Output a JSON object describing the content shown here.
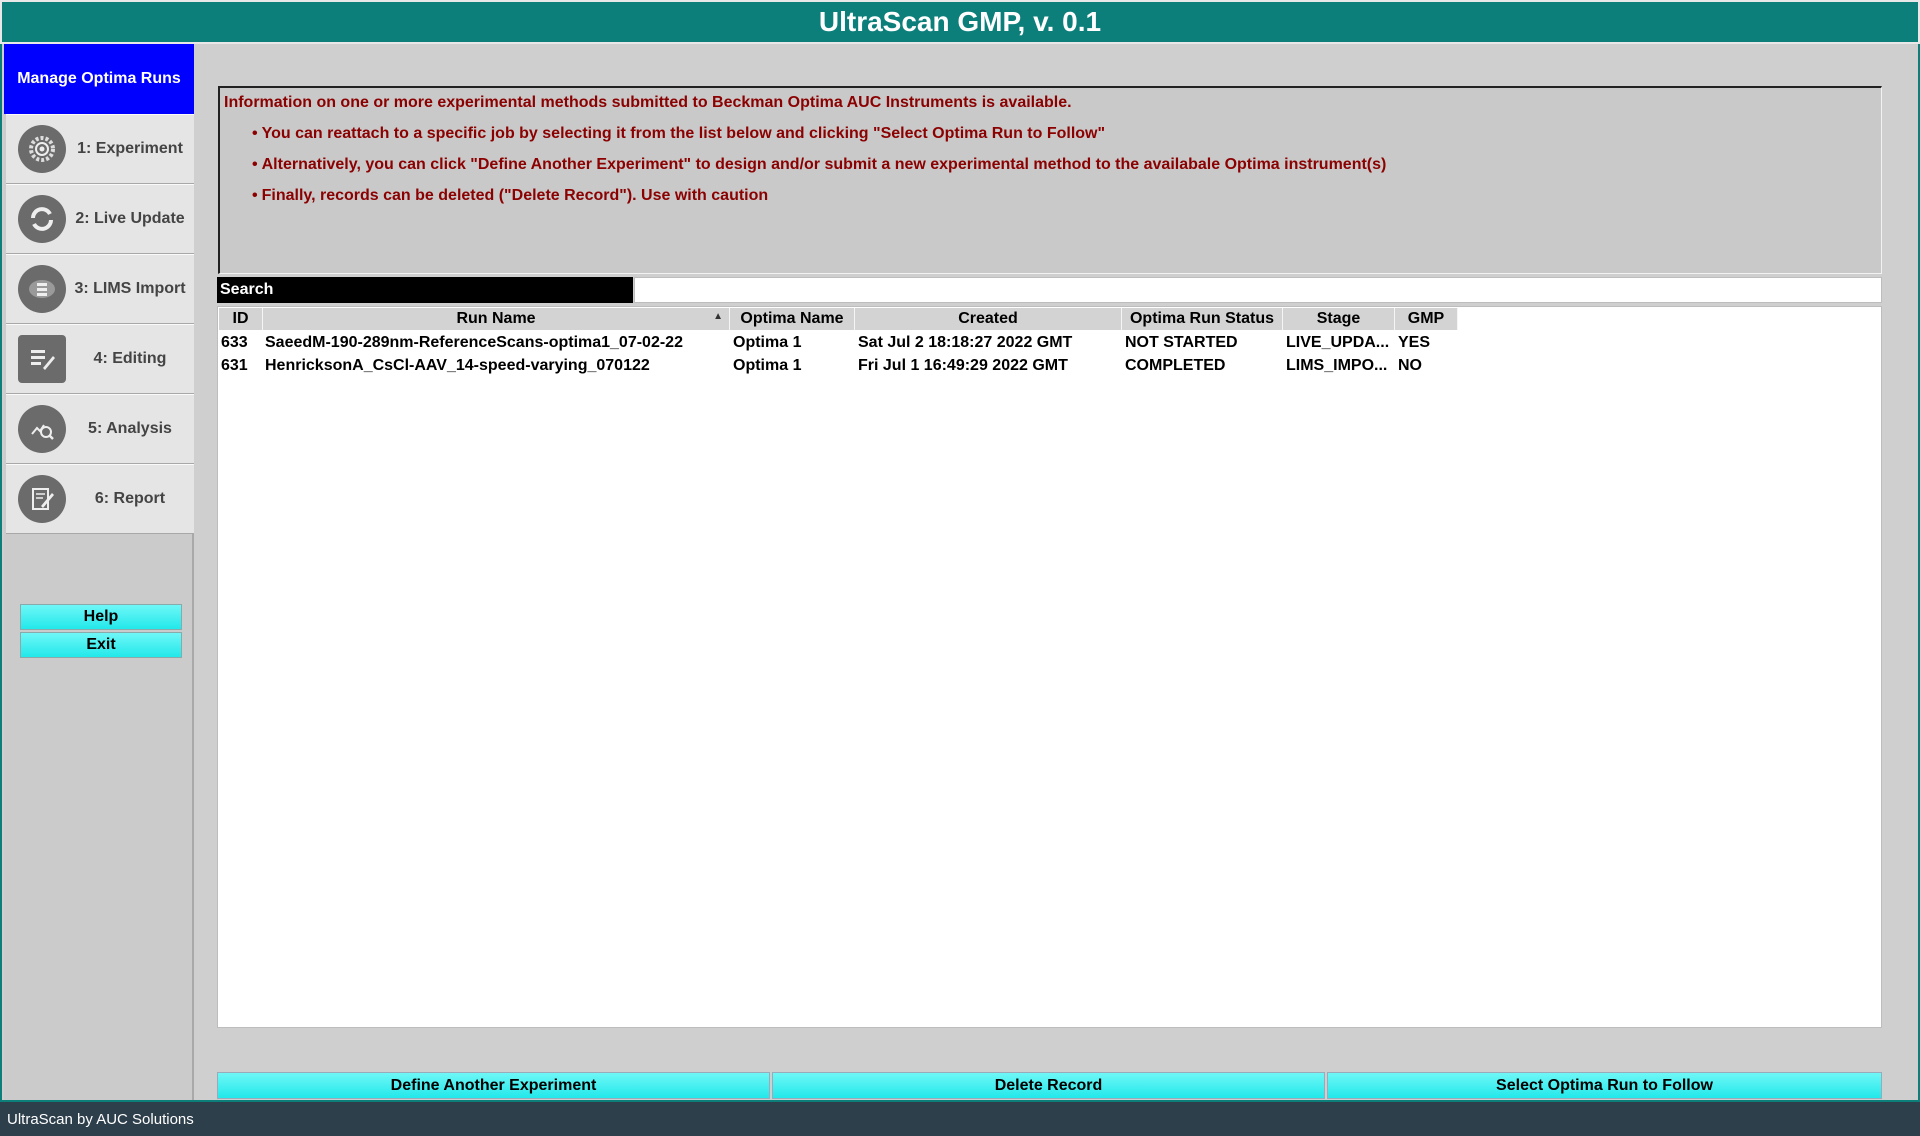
{
  "window": {
    "title": "UltraScan GMP, v. 0.1"
  },
  "sidebar": {
    "header": "Manage Optima Runs",
    "items": [
      {
        "label": "1: Experiment",
        "icon": "gear-icon"
      },
      {
        "label": "2: Live Update",
        "icon": "refresh-icon"
      },
      {
        "label": "3: LIMS Import",
        "icon": "cloud-database-icon"
      },
      {
        "label": "4: Editing",
        "icon": "edit-icon"
      },
      {
        "label": "5: Analysis",
        "icon": "chart-search-icon"
      },
      {
        "label": "6: Report",
        "icon": "report-icon"
      }
    ],
    "help_label": "Help",
    "exit_label": "Exit"
  },
  "info": {
    "heading": "Information on one or more experimental methods submitted to Beckman Optima AUC Instruments is available.",
    "bullets": [
      "You can reattach to a specific job by selecting it from the list below and clicking \"Select Optima Run to Follow\"",
      "Alternatively, you can click \"Define Another Experiment\" to design and/or submit a new experimental method to the availabale Optima instrument(s)",
      "Finally, records can be deleted (\"Delete Record\"). Use with caution"
    ]
  },
  "search": {
    "label": "Search",
    "value": ""
  },
  "table": {
    "columns": [
      "ID",
      "Run Name",
      "Optima Name",
      "Created",
      "Optima Run Status",
      "Stage",
      "GMP"
    ],
    "sort_column": "Run Name",
    "rows": [
      {
        "id": "633",
        "run_name": "SaeedM-190-289nm-ReferenceScans-optima1_07-02-22",
        "optima_name": "Optima 1",
        "created": "Sat Jul 2 18:18:27 2022 GMT",
        "status": "NOT STARTED",
        "stage": "LIVE_UPDA...",
        "gmp": "YES"
      },
      {
        "id": "631",
        "run_name": "HenricksonA_CsCl-AAV_14-speed-varying_070122",
        "optima_name": "Optima 1",
        "created": "Fri Jul 1 16:49:29 2022 GMT",
        "status": "COMPLETED",
        "stage": "LIMS_IMPO...",
        "gmp": "NO"
      }
    ]
  },
  "buttons": {
    "define": "Define Another Experiment",
    "delete": "Delete Record",
    "select": "Select Optima Run to Follow"
  },
  "status_bar": {
    "text": "UltraScan by AUC Solutions"
  },
  "colors": {
    "title_bar": "#0d7f7b",
    "sidebar_header": "#0000ff",
    "button": "#22e8ea",
    "info_text": "#8b0000",
    "status_bar": "#2e3f4c"
  }
}
